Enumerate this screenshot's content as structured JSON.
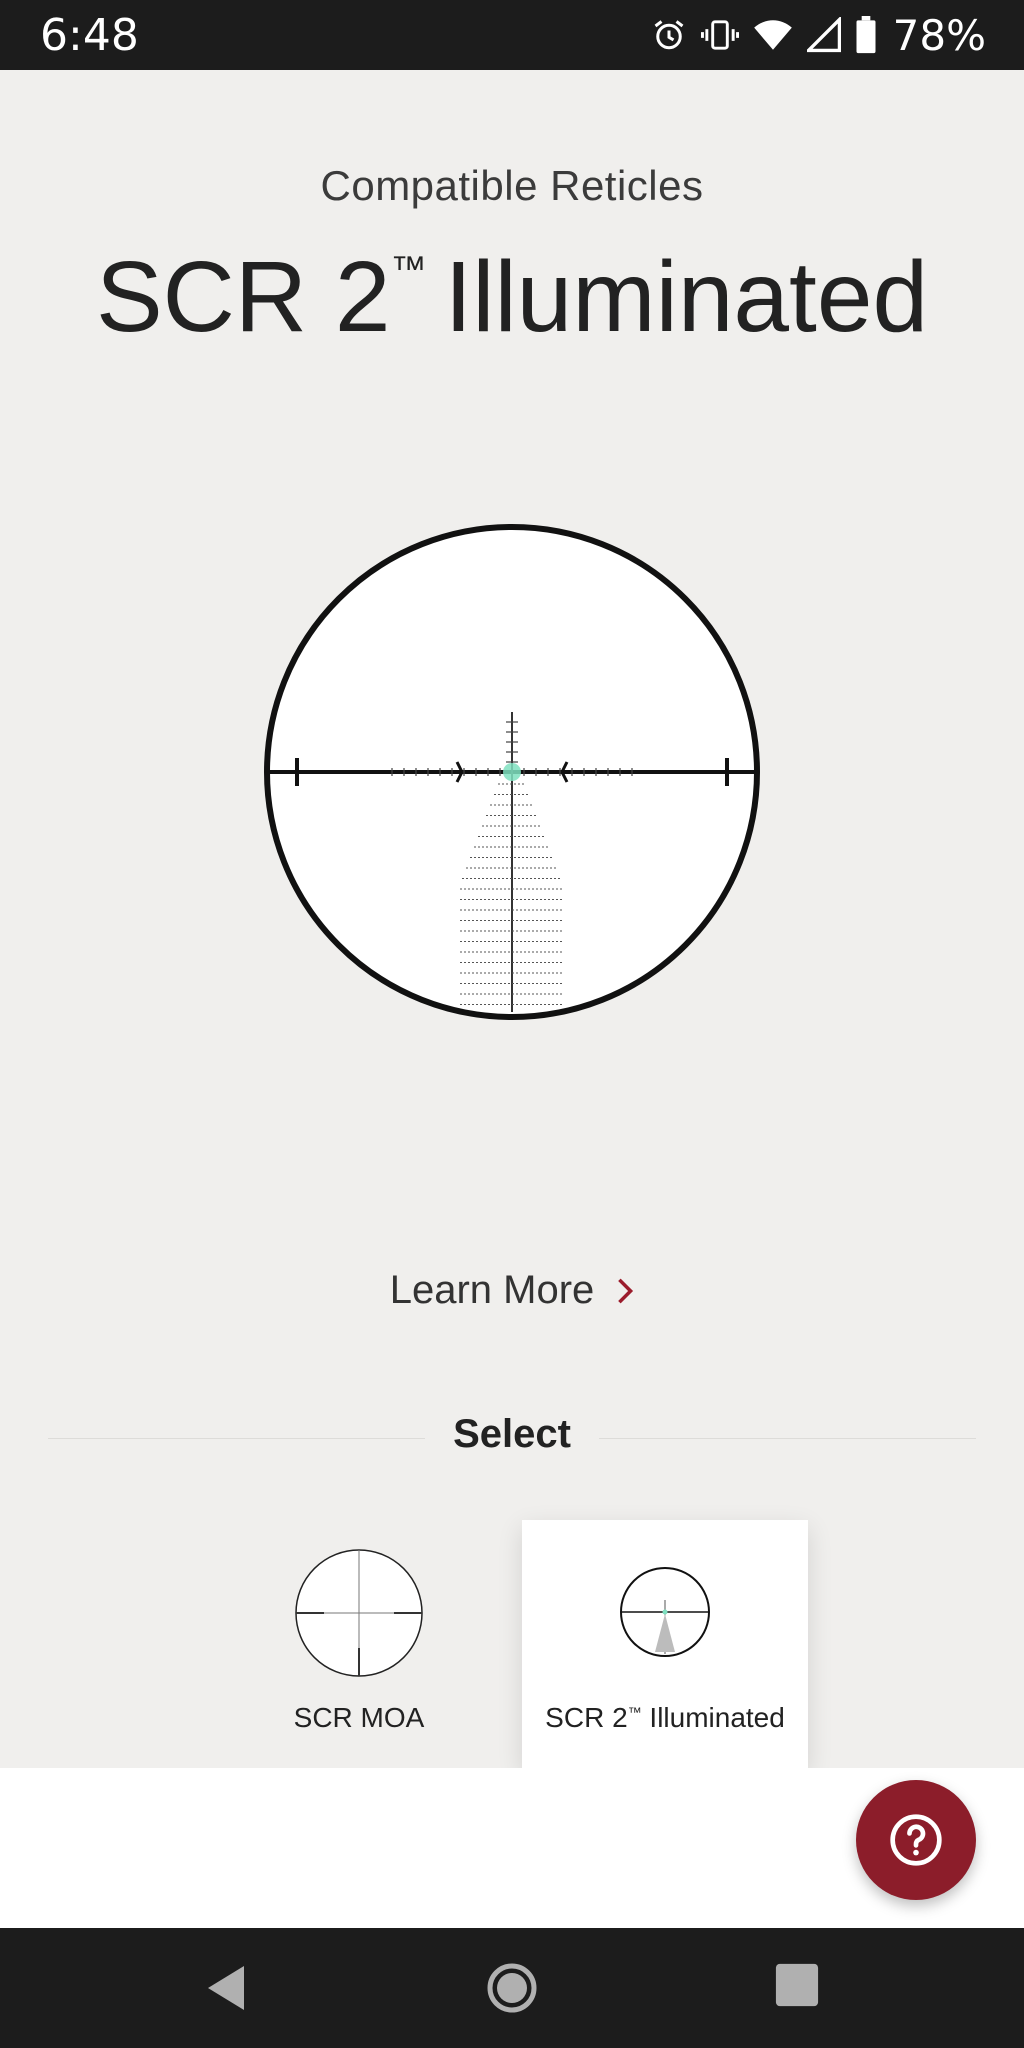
{
  "status_bar": {
    "time": "6:48",
    "battery": "78%",
    "icons": [
      "alarm-icon",
      "vibrate-icon",
      "wifi-icon",
      "cellular-signal-icon",
      "battery-icon"
    ]
  },
  "header": {
    "kicker": "Compatible Reticles",
    "title_main": "SCR 2",
    "title_tm": "™",
    "title_rest": "Illuminated"
  },
  "reticle_preview": {
    "name": "reticle-illustration",
    "illumination_color": "#7fe0c0"
  },
  "learn_more": {
    "label": "Learn More",
    "chevron": "chevron-right-icon",
    "chevron_color": "#9b1c2c"
  },
  "select": {
    "heading": "Select",
    "options": [
      {
        "label": "SCR MOA",
        "selected": false
      },
      {
        "label_main": "SCR 2",
        "label_tm": "™",
        "label_rest": " Illuminated",
        "selected": true
      }
    ]
  },
  "help_button": {
    "icon": "question-icon",
    "color": "#8c1d2a"
  },
  "nav_bar": {
    "buttons": [
      "back-icon",
      "home-icon",
      "recents-icon"
    ]
  }
}
